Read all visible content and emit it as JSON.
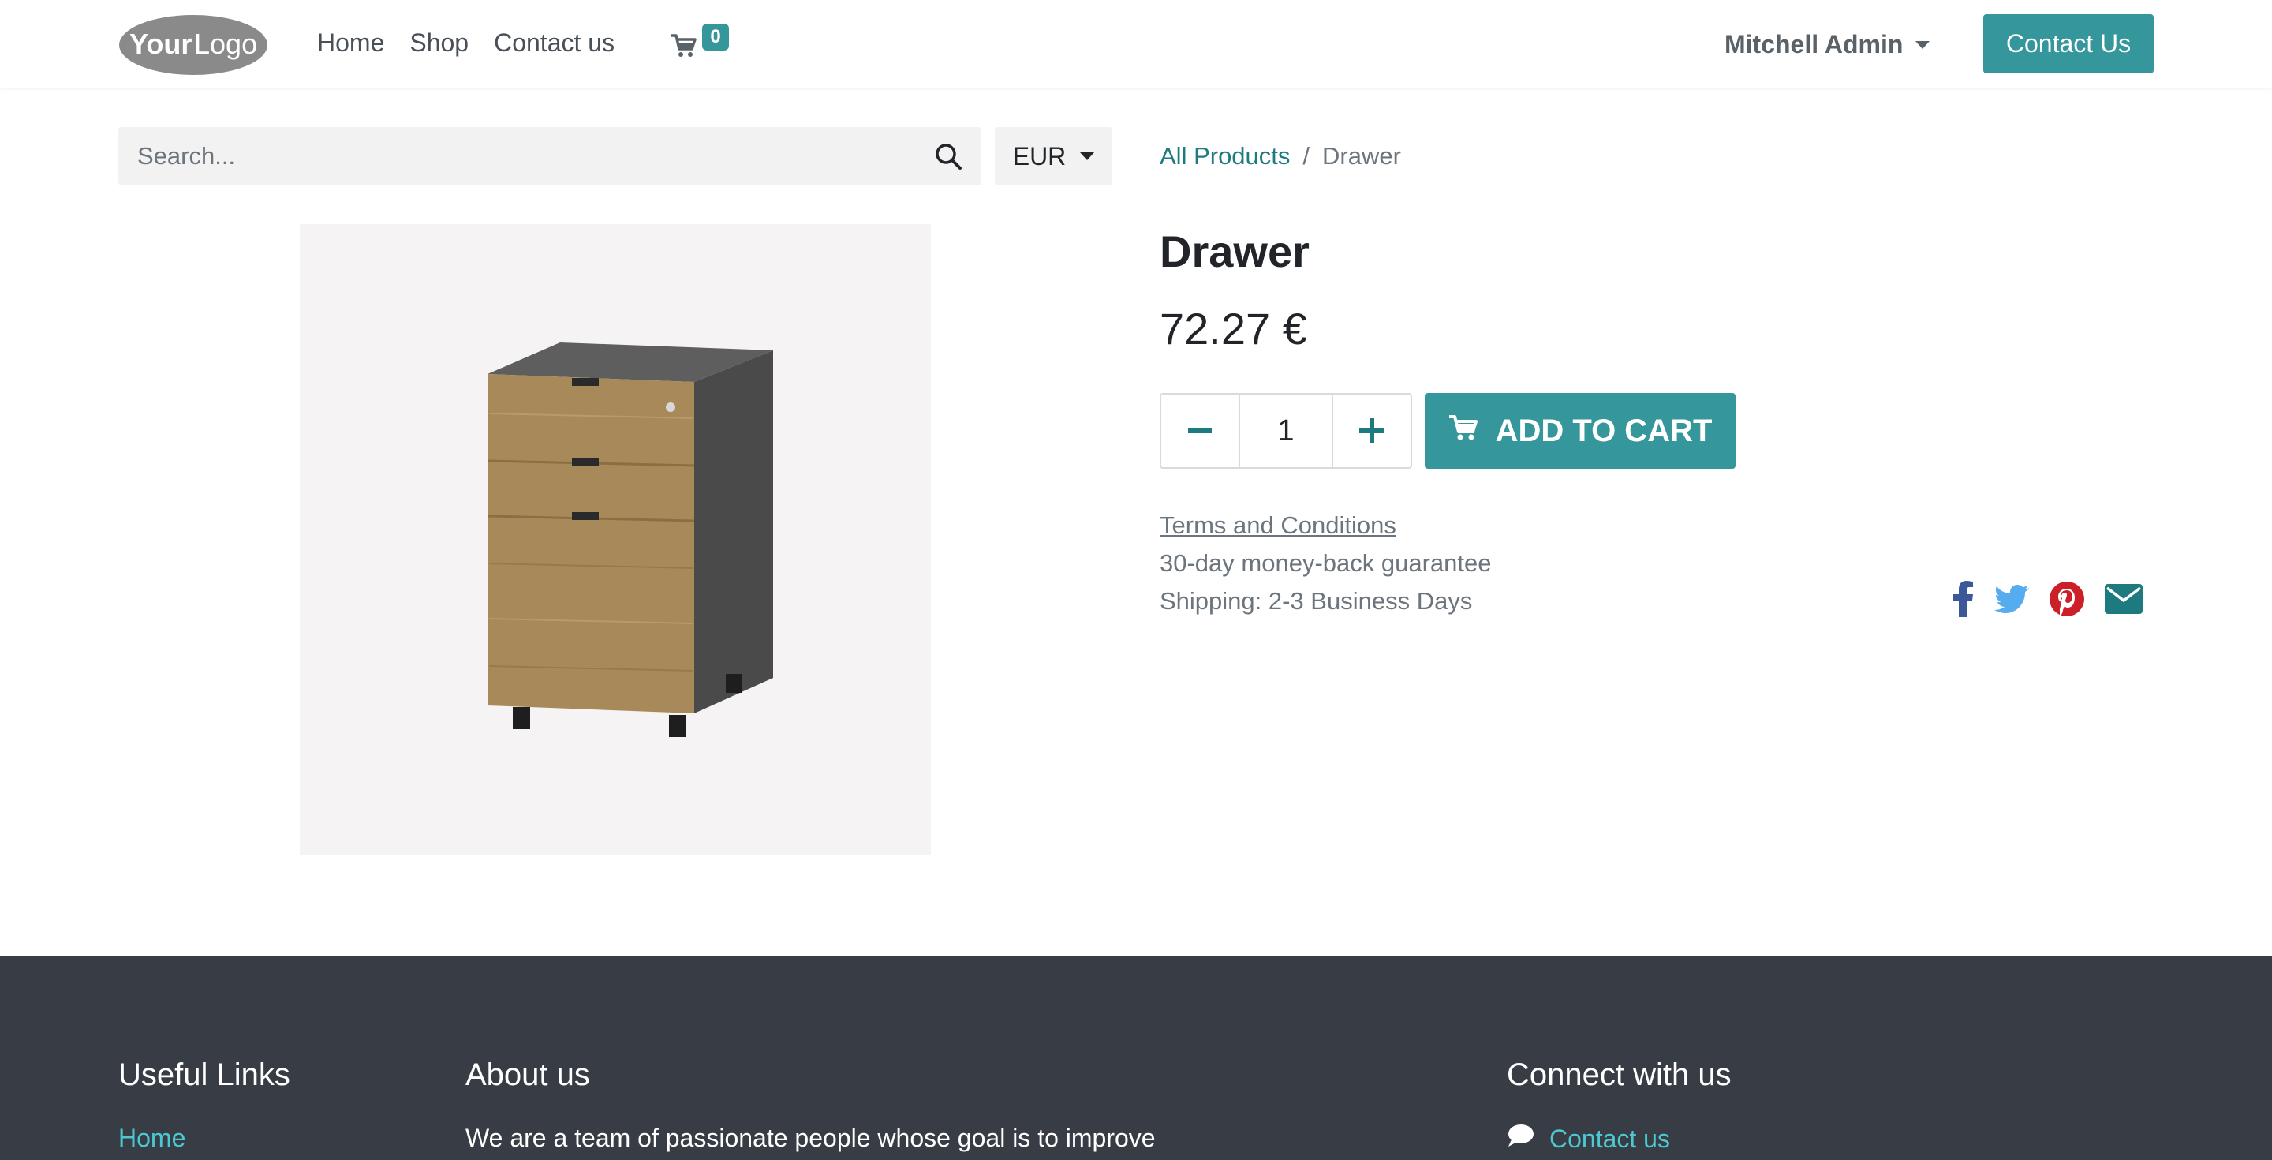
{
  "colors": {
    "accent": "#35979c",
    "link": "#1d7b80",
    "footer_bg": "#383d45",
    "footer_link": "#4cc8d0",
    "ribbon": "#6b4a78"
  },
  "header": {
    "logo_icon": "yourlogo-logo",
    "nav": [
      "Home",
      "Shop",
      "Contact us"
    ],
    "cart_count": "0",
    "user_name": "Mitchell Admin",
    "contact_button": "Contact Us"
  },
  "search": {
    "placeholder": "Search...",
    "icon": "search-icon"
  },
  "currency": {
    "selected": "EUR"
  },
  "breadcrumb": {
    "parent": "All Products",
    "separator": "/",
    "current": "Drawer"
  },
  "product": {
    "name": "Drawer",
    "price": "72.27 €",
    "quantity": "1",
    "add_to_cart": "ADD TO CART",
    "terms": "Terms and Conditions",
    "guarantee": "30-day money-back guarantee",
    "shipping": "Shipping: 2-3 Business Days"
  },
  "social": [
    "facebook-icon",
    "twitter-icon",
    "pinterest-icon",
    "email-icon"
  ],
  "footer": {
    "useful_links_heading": "Useful Links",
    "useful_links": [
      "Home"
    ],
    "about_heading": "About us",
    "about_text": "We are a team of passionate people whose goal is to improve",
    "connect_heading": "Connect with us",
    "connect_link": "Contact us"
  }
}
